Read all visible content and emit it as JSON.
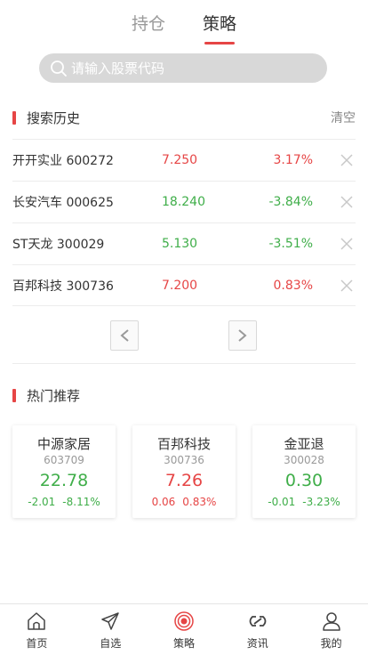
{
  "top_tabs": [
    {
      "label": "持仓"
    },
    {
      "label": "策略"
    }
  ],
  "search": {
    "placeholder": "请输入股票代码"
  },
  "history": {
    "title": "搜索历史",
    "clear_label": "清空",
    "rows": [
      {
        "name": "开开实业 600272",
        "price": "7.250",
        "change": "3.17%",
        "trend": "up"
      },
      {
        "name": "长安汽车 000625",
        "price": "18.240",
        "change": "-3.84%",
        "trend": "down"
      },
      {
        "name": "ST天龙 300029",
        "price": "5.130",
        "change": "-3.51%",
        "trend": "down"
      },
      {
        "name": "百邦科技 300736",
        "price": "7.200",
        "change": "0.83%",
        "trend": "up"
      }
    ]
  },
  "pager": {
    "prev": "<",
    "next": ">"
  },
  "hot": {
    "title": "热门推荐",
    "cards": [
      {
        "name": "中源家居",
        "code": "603709",
        "price": "22.78",
        "delta": "-2.01",
        "pct": "-8.11%",
        "trend": "down"
      },
      {
        "name": "百邦科技",
        "code": "300736",
        "price": "7.26",
        "delta": "0.06",
        "pct": "0.83%",
        "trend": "up"
      },
      {
        "name": "金亚退",
        "code": "300028",
        "price": "0.30",
        "delta": "-0.01",
        "pct": "-3.23%",
        "trend": "down"
      }
    ]
  },
  "nav": [
    {
      "label": "首页",
      "icon": "home-icon"
    },
    {
      "label": "自选",
      "icon": "send-icon"
    },
    {
      "label": "策略",
      "icon": "target-icon"
    },
    {
      "label": "资讯",
      "icon": "link-icon"
    },
    {
      "label": "我的",
      "icon": "user-icon"
    }
  ],
  "colors": {
    "accent": "#e64545",
    "up": "#e64545",
    "down": "#3fae49"
  }
}
